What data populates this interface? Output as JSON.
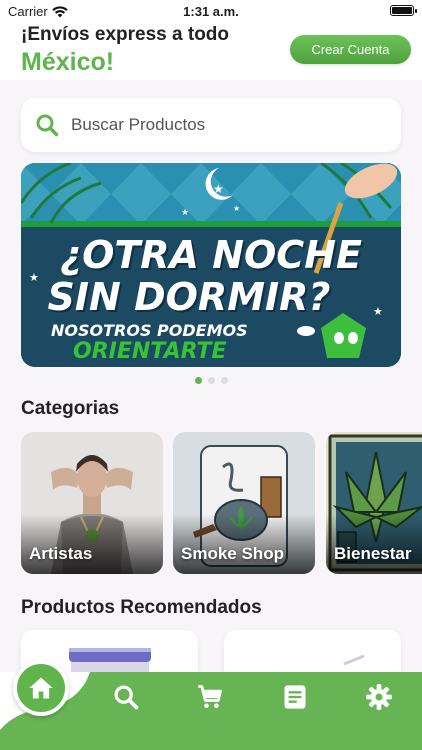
{
  "status_bar": {
    "carrier": "Carrier",
    "time": "1:31 a.m."
  },
  "header": {
    "shipping_line1": "¡Envíos express a todo",
    "shipping_line2": "México!",
    "create_account_label": "Crear Cuenta"
  },
  "search": {
    "placeholder": "Buscar Productos",
    "value": ""
  },
  "banner": {
    "line1": "¿OTRA NOCHE",
    "line2": "SIN DORMIR?",
    "line3": "NOSOTROS PODEMOS",
    "line4": "ORIENTARTE"
  },
  "carousel": {
    "total": 3,
    "active_index": 0
  },
  "categories": {
    "title": "Categorias",
    "items": [
      {
        "label": "Artistas"
      },
      {
        "label": "Smoke Shop"
      },
      {
        "label": "Bienestar"
      }
    ]
  },
  "products": {
    "title": "Productos Recomendados"
  },
  "bottom_nav": {
    "items": [
      "home-icon",
      "search-icon",
      "cart-icon",
      "document-icon",
      "gear-icon"
    ],
    "active": "home-icon"
  },
  "colors": {
    "brand_green": "#5fb44c",
    "banner_blue": "#1d4a63"
  }
}
